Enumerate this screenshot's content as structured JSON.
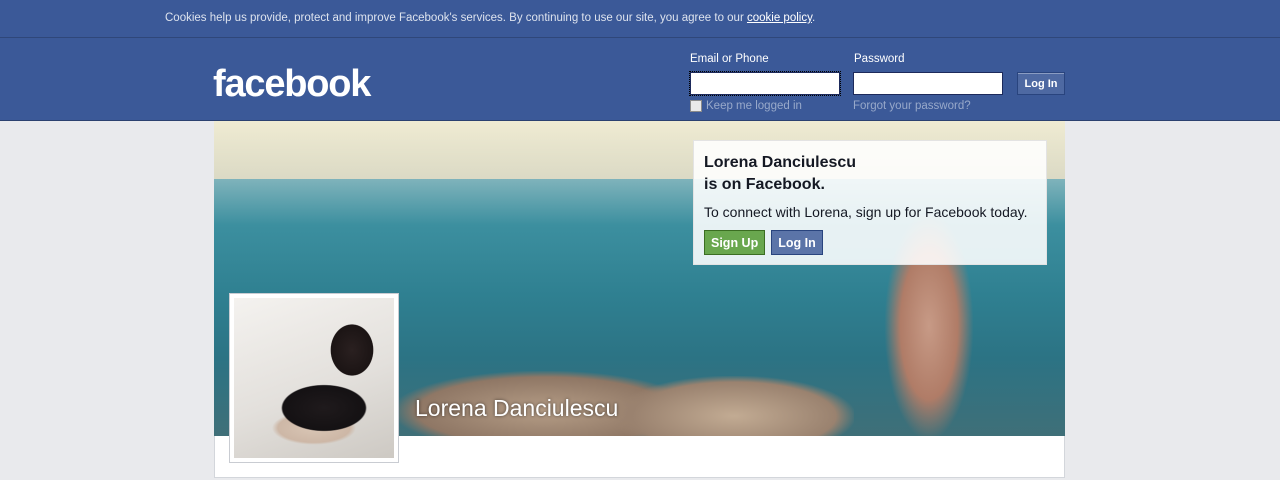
{
  "cookie_bar": {
    "text": "Cookies help us provide, protect and improve Facebook's services. By continuing to use our site, you agree to our ",
    "link": "cookie policy",
    "suffix": "."
  },
  "header": {
    "logo": "facebook",
    "email_label": "Email or Phone",
    "password_label": "Password",
    "email_value": "",
    "password_value": "",
    "login_button": "Log In",
    "keep_logged_in": "Keep me logged in",
    "forgot_password": "Forgot your password?"
  },
  "profile": {
    "name": "Lorena Danciulescu",
    "signup_title_line1": "Lorena Danciulescu",
    "signup_title_line2": "is on Facebook.",
    "signup_text": "To connect with Lorena, sign up for Facebook today.",
    "signup_button": "Sign Up",
    "login_button": "Log In"
  },
  "colors": {
    "brand_blue": "#3b5998",
    "signup_green": "#69a74e",
    "page_bg": "#e9eaed"
  }
}
